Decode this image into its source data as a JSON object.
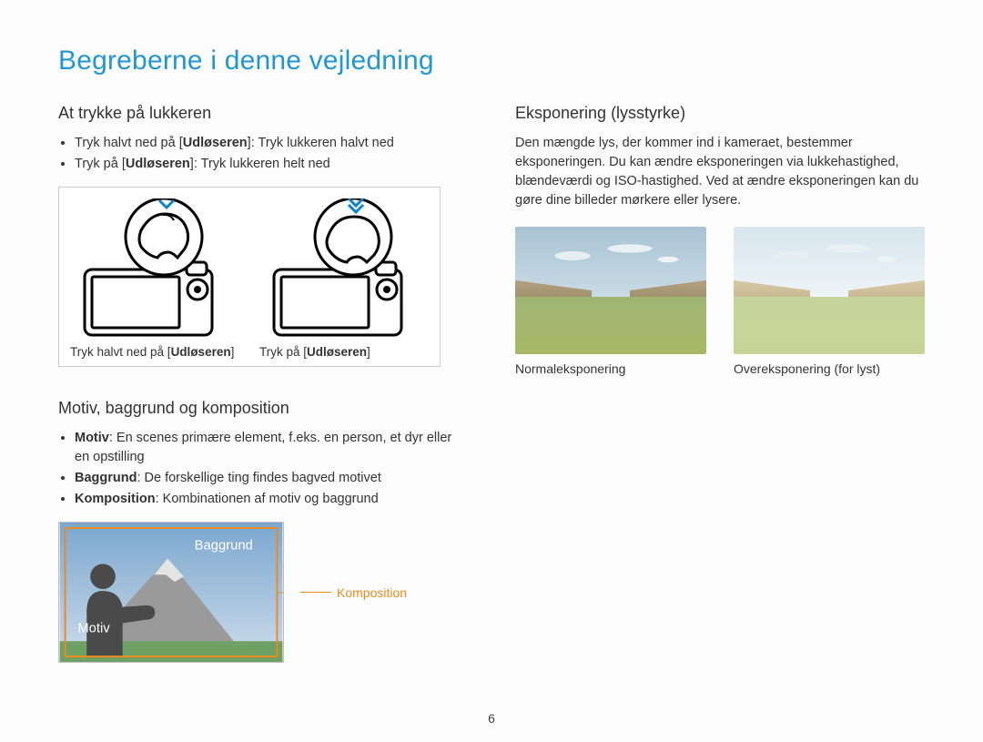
{
  "page_title": "Begreberne i denne vejledning",
  "page_number": "6",
  "left": {
    "shutter": {
      "heading": "At trykke på lukkeren",
      "bullets": [
        {
          "pre": "Tryk halvt ned på [",
          "bold": "Udløseren",
          "post": "]: Tryk lukkeren halvt ned"
        },
        {
          "pre": "Tryk på [",
          "bold": "Udløseren",
          "post": "]: Tryk lukkeren helt ned"
        }
      ],
      "fig1_pre": "Tryk halvt ned på [",
      "fig1_bold": "Udløseren",
      "fig1_post": "]",
      "fig2_pre": "Tryk på [",
      "fig2_bold": "Udløseren",
      "fig2_post": "]"
    },
    "composition": {
      "heading": "Motiv, baggrund og komposition",
      "bullets": {
        "motiv_label": "Motiv",
        "motiv_text": ": En scenes primære element, f.eks. en person, et dyr eller en opstilling",
        "baggrund_label": "Baggrund",
        "baggrund_text": ": De forskellige ting findes bagved motivet",
        "komposition_label": "Komposition",
        "komposition_text": ": Kombinationen af motiv og baggrund"
      },
      "fig_baggrund": "Baggrund",
      "fig_motiv": "Motiv",
      "fig_komposition": "Komposition"
    }
  },
  "right": {
    "heading": "Eksponering (lysstyrke)",
    "body": "Den mængde lys, der kommer ind i kameraet, bestemmer eksponeringen. Du kan ændre eksponeringen via lukkehastighed, blændeværdi og ISO-hastighed. Ved at ændre eksponeringen kan du gøre dine billeder mørkere eller lysere.",
    "cap_normal": "Normaleksponering",
    "cap_over": "Overeksponering (for lyst)"
  }
}
